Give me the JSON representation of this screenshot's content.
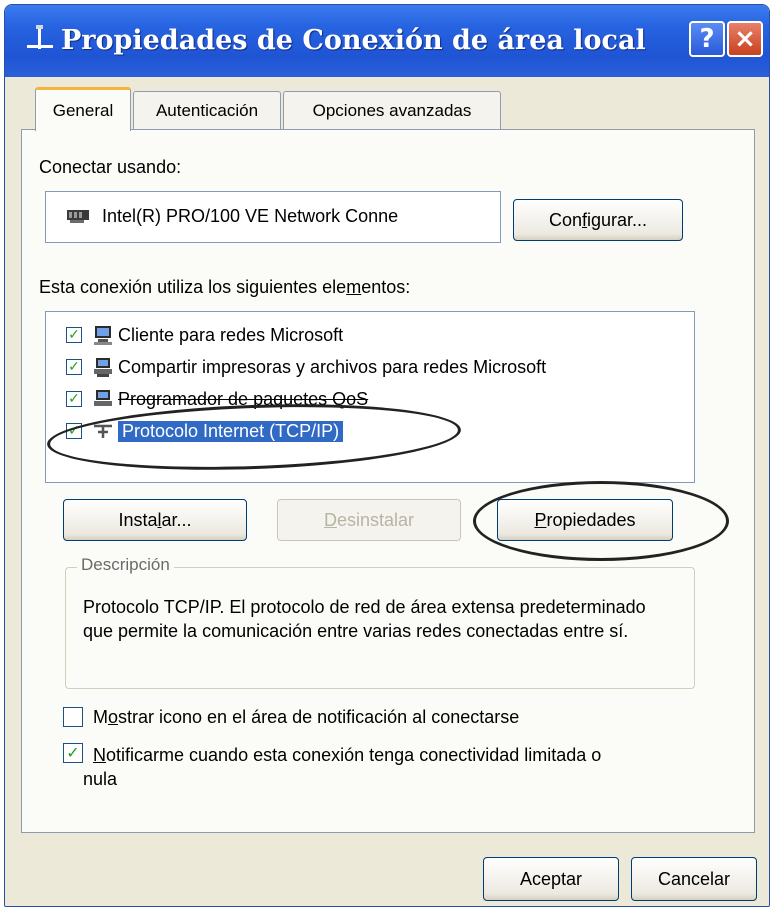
{
  "window": {
    "title": "Propiedades de Conexión de área local",
    "help_label": "?",
    "close_label": "×"
  },
  "tabs": [
    {
      "label": "General",
      "active": true
    },
    {
      "label": "Autenticación",
      "active": false
    },
    {
      "label": "Opciones avanzadas",
      "active": false
    }
  ],
  "connect": {
    "label": "Conectar usando:",
    "adapter": "Intel(R) PRO/100 VE Network Conne",
    "configure_pre": "Con",
    "configure_key": "f",
    "configure_post": "igurar..."
  },
  "components": {
    "label_pre": "Esta conexión utiliza los siguientes ele",
    "label_key": "m",
    "label_post": "entos:",
    "items": [
      {
        "label": "Cliente para redes Microsoft",
        "checked": true
      },
      {
        "label": "Compartir impresoras y archivos para redes Microsoft",
        "checked": true
      },
      {
        "label": "Programador de paquetes QoS",
        "checked": true
      },
      {
        "label": "Protocolo Internet (TCP/IP)",
        "checked": true,
        "selected": true
      }
    ]
  },
  "buttons": {
    "install_pre": "Insta",
    "install_key": "l",
    "install_post": "ar...",
    "uninstall_pre": "",
    "uninstall_key": "D",
    "uninstall_post": "esinstalar",
    "properties_pre": "",
    "properties_key": "P",
    "properties_post": "ropiedades"
  },
  "description": {
    "legend": "Descripción",
    "text": "Protocolo TCP/IP. El protocolo de red de área extensa predeterminado que permite la comunicación entre varias redes conectadas entre sí."
  },
  "options": {
    "show_icon_pre": "M",
    "show_icon_key": "o",
    "show_icon_post": "strar icono en el área de notificación al conectarse",
    "show_icon_checked": false,
    "notify_key": "N",
    "notify_line1": "otificarme cuando esta conexión tenga conectividad limitada o",
    "notify_line2": "nula",
    "notify_checked": true
  },
  "footer": {
    "accept": "Aceptar",
    "cancel": "Cancelar"
  },
  "colors": {
    "title_bar": "#2763e0",
    "selection": "#316ac5",
    "check_mark": "#21a121"
  }
}
